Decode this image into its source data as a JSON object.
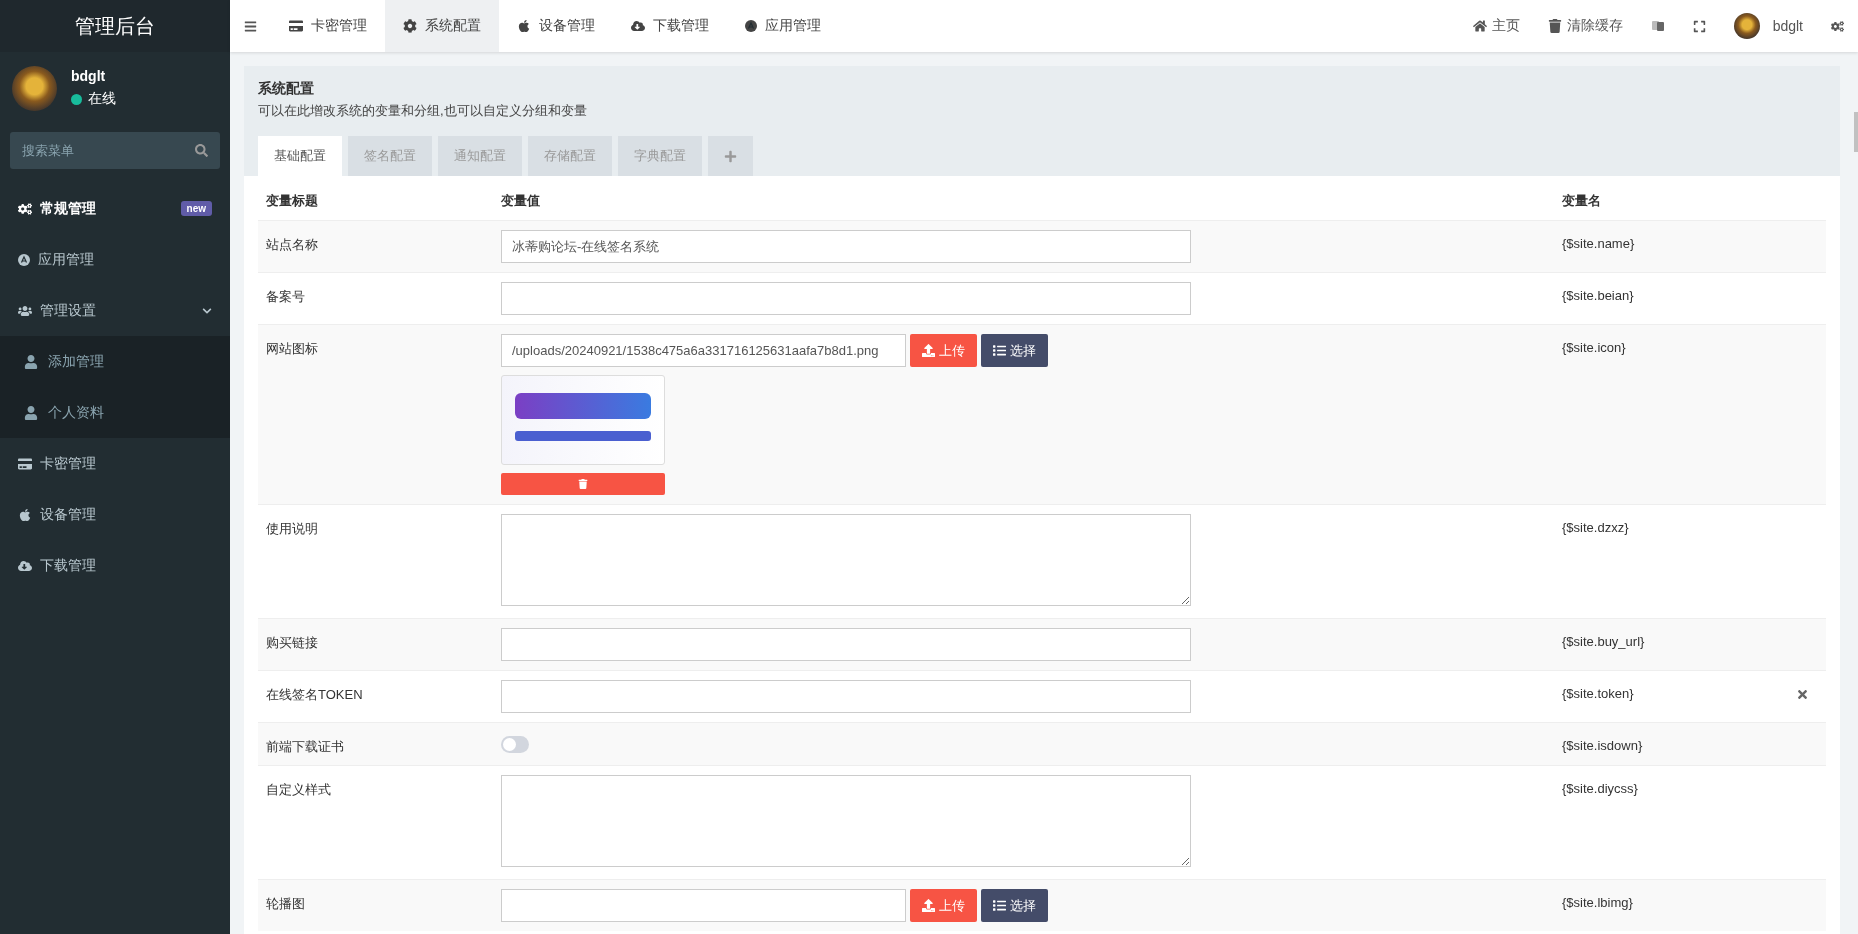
{
  "sidebar": {
    "title": "管理后台",
    "user": {
      "name": "bdglt",
      "status": "在线",
      "online": true
    },
    "search": {
      "placeholder": "搜索菜单"
    },
    "menu": [
      {
        "label": "常规管理",
        "badge": "new"
      },
      {
        "label": "应用管理"
      },
      {
        "label": "管理设置",
        "expanded": true,
        "children": [
          {
            "label": "添加管理"
          },
          {
            "label": "个人资料"
          }
        ]
      },
      {
        "label": "卡密管理"
      },
      {
        "label": "设备管理"
      },
      {
        "label": "下载管理"
      }
    ]
  },
  "topbar": {
    "tabs": [
      {
        "label": "卡密管理",
        "selected": false
      },
      {
        "label": "系统配置",
        "selected": true
      },
      {
        "label": "设备管理",
        "selected": false
      },
      {
        "label": "下载管理",
        "selected": false
      },
      {
        "label": "应用管理",
        "selected": false
      }
    ],
    "links": [
      "主页",
      "清除缓存"
    ],
    "user": "bdglt"
  },
  "panel": {
    "title": "系统配置",
    "description": "可以在此增改系统的变量和分组,也可以自定义分组和变量",
    "tabs": [
      {
        "label": "基础配置",
        "selected": true
      },
      {
        "label": "签名配置",
        "selected": false
      },
      {
        "label": "通知配置",
        "selected": false
      },
      {
        "label": "存储配置",
        "selected": false
      },
      {
        "label": "字典配置",
        "selected": false
      }
    ],
    "columns": [
      "变量标题",
      "变量值",
      "变量名"
    ],
    "rows": [
      {
        "kind": "text",
        "title": "站点名称",
        "value": "冰蒂购论坛-在线签名系统",
        "name": "{$site.name}",
        "removable": false
      },
      {
        "kind": "text",
        "title": "备案号",
        "name": "{$site.beian}",
        "removable": false
      },
      {
        "kind": "image",
        "title": "网站图标",
        "value": "/uploads/20240921/1538c475a6a331716125631aafa7b8d1.png",
        "upload": "上传",
        "choose": "选择",
        "name": "{$site.icon}",
        "removable": false
      },
      {
        "kind": "textarea",
        "title": "使用说明",
        "name": "{$site.dzxz}",
        "removable": false
      },
      {
        "kind": "text",
        "title": "购买链接",
        "name": "{$site.buy_url}",
        "removable": false
      },
      {
        "kind": "text",
        "title": "在线签名TOKEN",
        "name": "{$site.token}",
        "removable": true
      },
      {
        "kind": "switch",
        "title": "前端下载证书",
        "on": false,
        "name": "{$site.isdown}",
        "removable": false
      },
      {
        "kind": "textarea",
        "title": "自定义样式",
        "name": "{$site.diycss}",
        "removable": false
      },
      {
        "kind": "upload",
        "title": "轮播图",
        "upload": "上传",
        "choose": "选择",
        "name": "{$site.lbimg}",
        "removable": false
      }
    ]
  }
}
